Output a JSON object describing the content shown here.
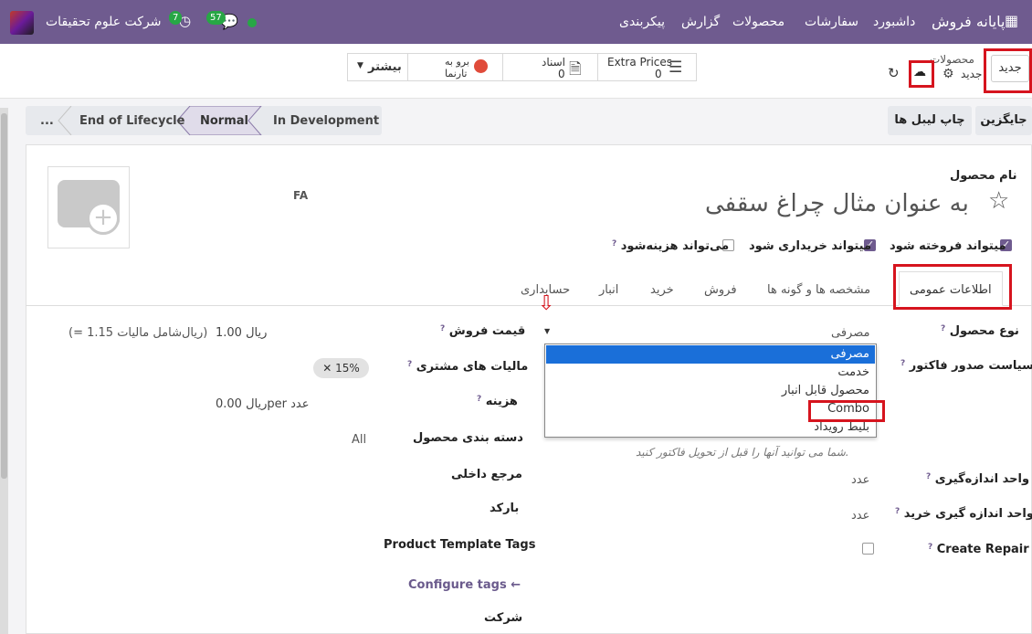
{
  "navbar": {
    "app_name": "پایانه فروش",
    "menu": [
      "داشبورد",
      "سفارشات",
      "محصولات",
      "گزارش",
      "پیکربندی"
    ],
    "messages_count": "57",
    "activities_count": "7",
    "company": "شرکت علوم تحقیقات"
  },
  "control_panel": {
    "new_button": "جدید",
    "breadcrumb_parent": "محصولات",
    "breadcrumb_current": "جدید",
    "stats": {
      "extra_prices_label": "Extra Prices",
      "extra_prices_count": "0",
      "documents_label": "اسناد",
      "documents_count": "0",
      "website_line1": "برو به",
      "website_line2": "تارنما",
      "more_label": "بیشتر"
    }
  },
  "actions": {
    "replace_button": "جایگزین",
    "print_labels_button": "چاپ لیبل ها"
  },
  "stages": [
    "In Development",
    "Normal",
    "End of Lifecycle",
    "..."
  ],
  "form": {
    "name_label": "نام محصول",
    "name_value": "به عنوان مثال چراغ سقفی",
    "lang_badge": "FA",
    "checks": {
      "can_be_sold": "میتواند فروخته شود",
      "can_be_purchased": "میتواند خریداری شود",
      "can_be_expensed": "می‌تواند هزینه‌شود"
    },
    "tabs": [
      "اطلاعات عمومی",
      "مشخصه ها و گونه ها",
      "فروش",
      "خرید",
      "انبار",
      "حسابداری"
    ],
    "left": {
      "product_type_label": "نوع محصول",
      "product_type_value": "مصرفی",
      "invoice_policy_label": "سیاست صدور فاکتور",
      "invoice_hint": "شما می توانید آنها را قبل از تحویل فاکتور کنید.",
      "uom_label": "واحد اندازه‌گیری",
      "uom_value": "عدد",
      "purchase_uom_label": "واحد اندازه گیری خرید",
      "purchase_uom_value": "عدد",
      "create_repair_label": "Create Repair"
    },
    "right": {
      "sales_price_label": "قیمت فروش",
      "sales_price_value": "1.00 ریال",
      "sales_price_tax": "(= 1.15 ریال‌شامل مالیات)",
      "customer_taxes_label": "مالیات های مشتری",
      "customer_taxes_tag": "15%",
      "cost_label": "هزینه",
      "cost_value": "0.00 ریالper عدد",
      "category_label": "دسته بندی محصول",
      "category_value": "All",
      "internal_ref_label": "مرجع داخلی",
      "barcode_label": "بارکد",
      "template_tags_label": "Product Template Tags",
      "configure_tags": "Configure tags",
      "company_label": "شرکت"
    }
  },
  "dropdown": {
    "options": [
      "مصرفی",
      "خدمت",
      "محصول قابل انبار",
      "Combo",
      "بلیط رویداد"
    ],
    "selected_index": 0
  }
}
